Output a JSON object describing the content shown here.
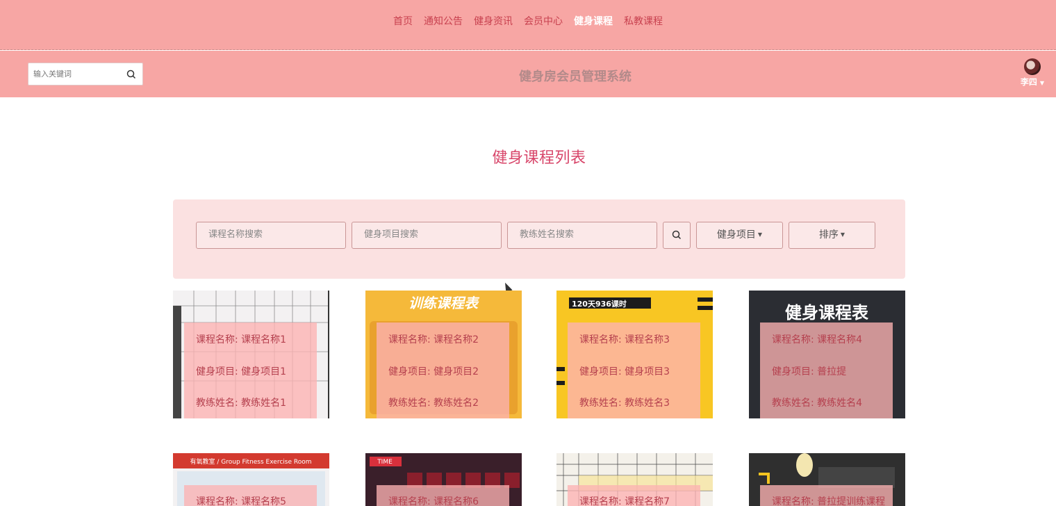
{
  "nav": {
    "items": [
      {
        "label": "首页",
        "active": false
      },
      {
        "label": "通知公告",
        "active": false
      },
      {
        "label": "健身资讯",
        "active": false
      },
      {
        "label": "会员中心",
        "active": false
      },
      {
        "label": "健身课程",
        "active": true
      },
      {
        "label": "私教课程",
        "active": false
      }
    ]
  },
  "header": {
    "search_placeholder": "输入关键词",
    "title": "健身房会员管理系统",
    "username": "李四"
  },
  "page": {
    "title": "健身课程列表"
  },
  "filters": {
    "course_name_placeholder": "课程名称搜索",
    "project_placeholder": "健身项目搜索",
    "coach_placeholder": "教练姓名搜索",
    "project_dropdown": "健身项目",
    "sort_dropdown": "排序"
  },
  "courses": [
    {
      "name_line": "课程名称: 课程名称1",
      "project_line": "健身项目: 健身项目1",
      "coach_line": "教练姓名: 教练姓名1",
      "bg": "#e9e4e6"
    },
    {
      "name_line": "课程名称: 课程名称2",
      "project_line": "健身项目: 健身项目2",
      "coach_line": "教练姓名: 教练姓名2",
      "bg": "#f5b93a"
    },
    {
      "name_line": "课程名称: 课程名称3",
      "project_line": "健身项目: 健身项目3",
      "coach_line": "教练姓名: 教练姓名3",
      "bg": "#f8c623"
    },
    {
      "name_line": "课程名称: 课程名称4",
      "project_line": "健身项目: 普拉提",
      "coach_line": "教练姓名: 教练姓名4",
      "bg": "#2b2d33"
    },
    {
      "name_line": "课程名称: 课程名称5",
      "bg": "#d33a2f"
    },
    {
      "name_line": "课程名称: 课程名称6",
      "bg": "#3a1f2a"
    },
    {
      "name_line": "课程名称: 课程名称7",
      "bg": "#f4f1ea"
    },
    {
      "name_line": "课程名称: 普拉提训练课程",
      "bg": "#2f2f2f"
    }
  ],
  "course_image_titles": {
    "c2": "训练课程表",
    "c3": "120天936课时",
    "c4": "健身课程表",
    "c5": "有氧教室 / Group Fitness Exercise Room",
    "c6": "TIME"
  },
  "colors": {
    "nav_bg": "#f7a6a4",
    "nav_link": "#c8414f",
    "title": "#d8466a",
    "panel_bg": "#fbe1e1"
  }
}
